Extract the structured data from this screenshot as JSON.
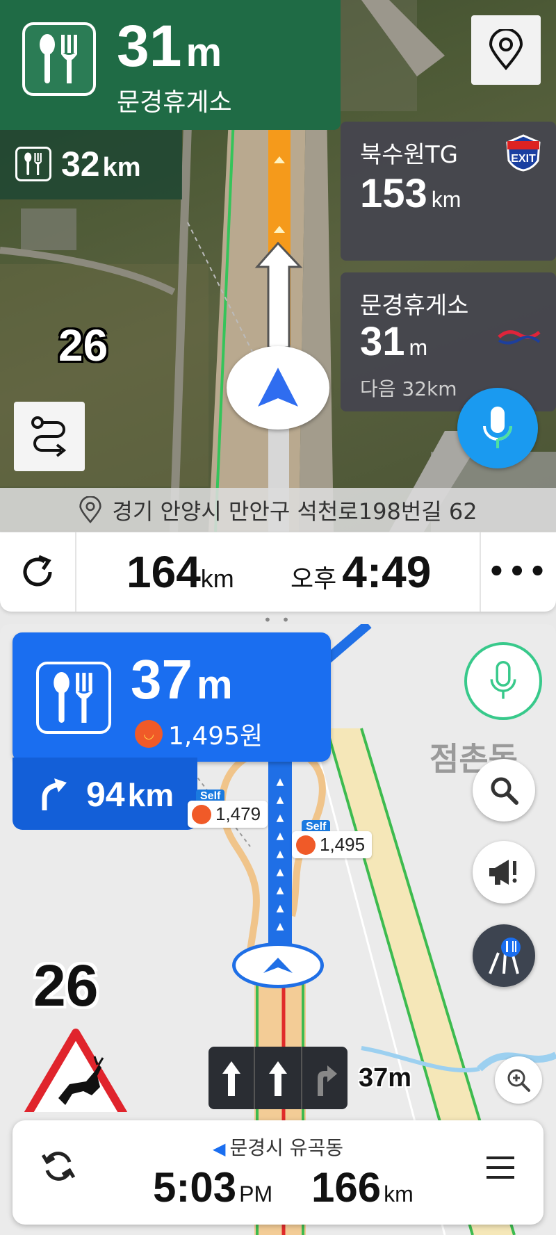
{
  "top_nav": {
    "guide": {
      "distance_value": "31",
      "distance_unit": "m",
      "name": "문경휴게소",
      "icon": "restaurant-icon"
    },
    "next_guide": {
      "distance_value": "32",
      "distance_unit": "km",
      "icon": "restaurant-icon"
    },
    "cards": [
      {
        "title": "북수원TG",
        "distance_value": "153",
        "distance_unit": "km",
        "sub": "",
        "icon": "exit-sign-icon"
      },
      {
        "title": "문경휴게소",
        "distance_value": "31",
        "distance_unit": "m",
        "sub": "다음 32km",
        "icon": "ex-logo-icon"
      }
    ],
    "speed_limit": "26",
    "address": "경기 안양시 만안구 석천로198번길 62",
    "status": {
      "remaining_value": "164",
      "remaining_unit": "km",
      "eta_ampm": "오후",
      "eta_time": "4:49",
      "more_label": "•••"
    }
  },
  "split_handle": "• • •",
  "bottom_nav": {
    "place_label": "점촌동",
    "guide": {
      "distance_value": "37",
      "distance_unit": "m",
      "price": "1,495원",
      "icon": "restaurant-icon"
    },
    "next_guide": {
      "distance_value": "94",
      "distance_unit": "km",
      "icon": "turn-right-arrow-icon"
    },
    "fuel_tags": [
      {
        "badge": "Self",
        "price": "1,479"
      },
      {
        "badge": "Self",
        "price": "1,495"
      }
    ],
    "speed_limit": "26",
    "lane_distance": "37m",
    "status": {
      "location": "문경시 유곡동",
      "eta_time": "5:03",
      "eta_ampm": "PM",
      "remaining_value": "166",
      "remaining_unit": "km"
    }
  },
  "colors": {
    "top_banner": "#1f6b45",
    "card_bg": "#46464e",
    "blue_banner": "#1a6ef0",
    "route_orange": "#f59a1b",
    "route_blue": "#1f6fe6",
    "mic_blue": "#1a9af0",
    "mic_green": "#38c98b"
  }
}
